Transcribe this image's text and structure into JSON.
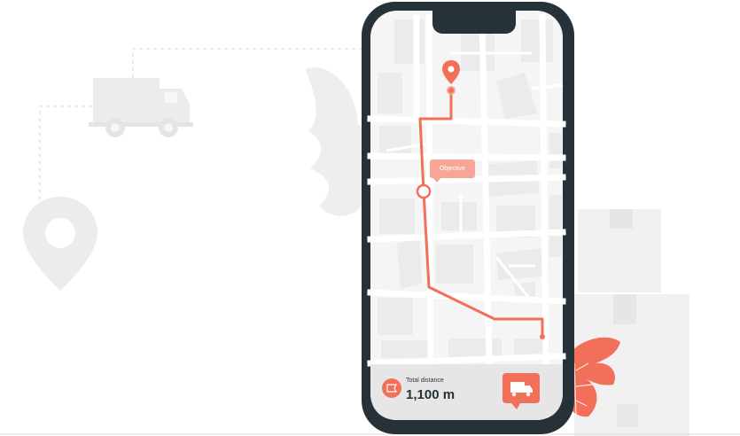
{
  "map": {
    "tooltip_label": "Objective"
  },
  "trip": {
    "distance_label": "Total distance",
    "distance_value": "1,100 m"
  },
  "colors": {
    "accent": "#f26f5a",
    "phone_frame": "#263238",
    "map_bg": "#f5f5f5",
    "block": "#ebebeb",
    "background_shapes": "#f0f0f0"
  },
  "icons": {
    "destination": "map-pin-icon",
    "origin": "flag-icon",
    "vehicle": "truck-icon"
  }
}
